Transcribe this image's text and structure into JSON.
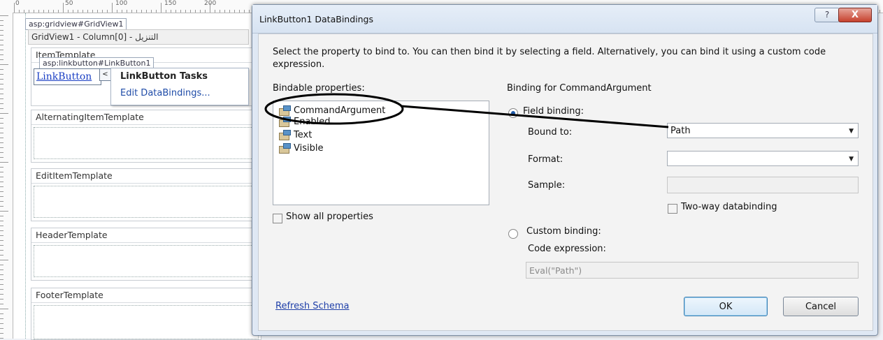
{
  "ruler": {
    "numbers": [
      "0",
      "50",
      "100",
      "150",
      "200"
    ]
  },
  "designer": {
    "gridview_tag": "asp:gridview#GridView1",
    "gridview_header": "GridView1 - Column[0] - التنزيل",
    "linkbutton_tag": "asp:linkbutton#LinkButton1",
    "linkbutton_text": "LinkButton",
    "item_template_title": "ItemTemplate",
    "tasks_title": "LinkButton Tasks",
    "tasks_link": "Edit DataBindings...",
    "templates": [
      "AlternatingItemTemplate",
      "EditItemTemplate",
      "HeaderTemplate",
      "FooterTemplate"
    ]
  },
  "dialog": {
    "title": "LinkButton1 DataBindings",
    "help_glyph": "?",
    "close_glyph": "X",
    "instruction": "Select the property to bind to. You can then bind it by selecting a field. Alternatively, you can bind it using a custom code expression.",
    "bindable_label": "Bindable properties:",
    "properties": [
      "CommandArgument",
      "Enabled",
      "Text",
      "Visible"
    ],
    "show_all_label": "Show all properties",
    "binding_for_label": "Binding for CommandArgument",
    "field_binding_label": "Field binding:",
    "bound_to_label": "Bound to:",
    "bound_to_value": "Path",
    "format_label": "Format:",
    "format_value": "",
    "sample_label": "Sample:",
    "sample_value": "",
    "two_way_label": "Two-way databinding",
    "custom_binding_label": "Custom binding:",
    "code_expression_label": "Code expression:",
    "code_expression_value": "Eval(\"Path\")",
    "refresh_schema": "Refresh Schema",
    "ok": "OK",
    "cancel": "Cancel"
  }
}
